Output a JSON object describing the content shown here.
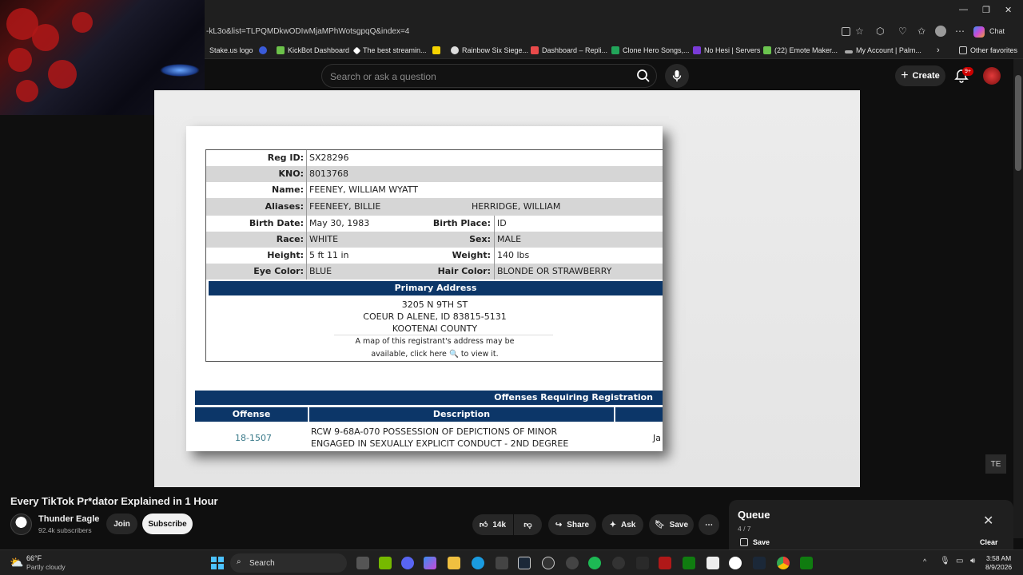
{
  "browser": {
    "url": "-kL3o&list=TLPQMDkwODIwMjaMPhWotsgpqQ&index=4",
    "copilot_label": "Chat",
    "favorites": [
      {
        "label": "Stake.us logo",
        "color": "#1f1f1f"
      },
      {
        "label": "",
        "color": "#3a5bd9"
      },
      {
        "label": "KickBot Dashboard",
        "color": "#6cc24a"
      },
      {
        "label": "The best streamin...",
        "color": "#ffffff"
      },
      {
        "label": "",
        "color": "#f5d300"
      },
      {
        "label": "Rainbow Six Siege...",
        "color": "#dddddd"
      },
      {
        "label": "Dashboard – Repli...",
        "color": "#e94a4a"
      },
      {
        "label": "Clone Hero Songs,...",
        "color": "#22a55a"
      },
      {
        "label": "No Hesi | Servers",
        "color": "#7a3bd8"
      },
      {
        "label": "(22) Emote Maker...",
        "color": "#6bc44f"
      },
      {
        "label": "My Account | Palm...",
        "color": "#aaaaaa"
      }
    ],
    "other_favorites": "Other favorites"
  },
  "youtube": {
    "search_placeholder": "Search or ask a question",
    "create_label": "Create",
    "notifications_badge": "9+"
  },
  "document": {
    "reg_id_label": "Reg ID:",
    "reg_id": "SX28296",
    "kno_label": "KNO:",
    "kno": "8013768",
    "name_label": "Name:",
    "name": "FEENEY, WILLIAM WYATT",
    "aliases_label": "Aliases:",
    "alias1": "FEENEEY, BILLIE",
    "alias2": "HERRIDGE, WILLIAM",
    "birth_date_label": "Birth Date:",
    "birth_date": "May 30, 1983",
    "birth_place_label": "Birth Place:",
    "birth_place": "ID",
    "race_label": "Race:",
    "race": "WHITE",
    "sex_label": "Sex:",
    "sex": "MALE",
    "height_label": "Height:",
    "height": "5 ft 11 in",
    "weight_label": "Weight:",
    "weight": "140 lbs",
    "eye_label": "Eye Color:",
    "eye": "BLUE",
    "hair_label": "Hair Color:",
    "hair": "BLONDE OR STRAWBERRY",
    "primary_address_heading": "Primary Address",
    "address_line1": "3205 N 9TH ST",
    "address_line2": "COEUR D ALENE, ID 83815-5131",
    "address_line3": "KOOTENAI COUNTY",
    "map_note1": "A map of this registrant's address may be",
    "map_note2_a": "available, click here",
    "map_note2_b": "to view it.",
    "offenses_heading": "Offenses Requiring Registration",
    "col_offense": "Offense",
    "col_description": "Description",
    "offense_code": "18-1507",
    "offense_desc1": "RCW 9-68A-070 POSSESSION OF DEPICTIONS OF MINOR",
    "offense_desc2": "ENGAGED IN SEXUALLY EXPLICIT CONDUCT - 2ND DEGREE",
    "offense_cut": "Ja"
  },
  "overlay_button": "TE",
  "video": {
    "title": "Every TikTok Pr*dator Explained in 1 Hour",
    "channel": "Thunder Eagle",
    "subscribers": "92.4k subscribers",
    "join": "Join",
    "subscribe": "Subscribe",
    "likes": "14k",
    "share": "Share",
    "ask": "Ask",
    "save": "Save"
  },
  "queue": {
    "title": "Queue",
    "count": "4 / 7",
    "save": "Save",
    "clear": "Clear"
  },
  "taskbar": {
    "temp": "66°F",
    "weather": "Partly cloudy",
    "search": "Search",
    "time": "3:58 AM",
    "date": "8/9/2026"
  }
}
